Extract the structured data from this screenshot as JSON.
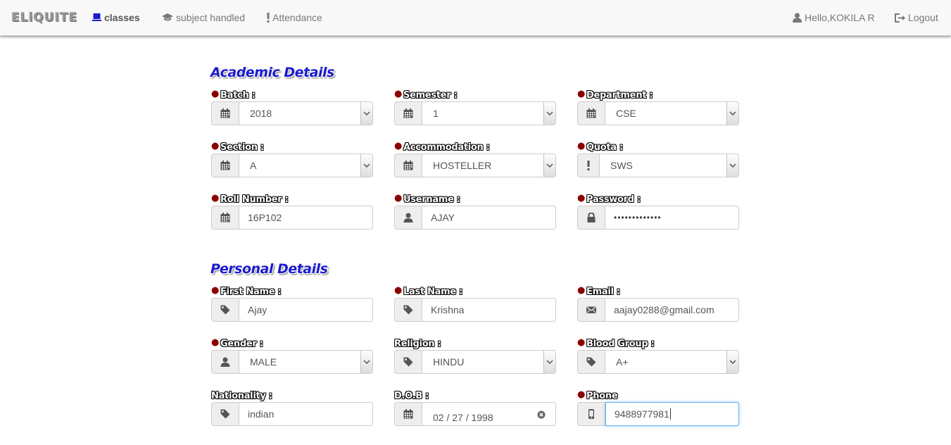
{
  "navbar": {
    "brand": "ELiQUITE",
    "items": [
      {
        "label": "classes",
        "icon": "laptop-icon",
        "active": true
      },
      {
        "label": "subject handled",
        "icon": "graduation-cap-icon"
      },
      {
        "label": "Attendance",
        "icon": "exclamation-icon"
      }
    ],
    "greeting": "Hello,KOKILA R",
    "logout": "Logout"
  },
  "academic": {
    "title": "Academic Details",
    "batch": {
      "label": "Batch :",
      "value": "2018",
      "icon": "calendar-icon",
      "required": true
    },
    "semester": {
      "label": "Semester :",
      "value": "1",
      "icon": "calendar-icon",
      "required": true
    },
    "department": {
      "label": "Department :",
      "value": "CSE",
      "icon": "calendar-icon",
      "required": true
    },
    "section": {
      "label": "Section :",
      "value": "A",
      "icon": "calendar-icon",
      "required": true
    },
    "accommodation": {
      "label": "Accommodation :",
      "value": "HOSTELLER",
      "icon": "calendar-icon",
      "required": true
    },
    "quota": {
      "label": "Quota :",
      "value": "SWS",
      "icon": "exclamation-icon",
      "required": true
    },
    "roll_number": {
      "label": "Roll Number :",
      "value": "16P102",
      "icon": "calendar-icon",
      "required": true
    },
    "username": {
      "label": "Username :",
      "value": "AJAY",
      "icon": "user-icon",
      "required": true
    },
    "password": {
      "label": "Password :",
      "value": "•••••••••••••",
      "icon": "lock-icon",
      "required": true
    }
  },
  "personal": {
    "title": "Personal Details",
    "first_name": {
      "label": "First Name :",
      "value": "Ajay",
      "icon": "tag-icon",
      "required": true
    },
    "last_name": {
      "label": "Last Name :",
      "value": "Krishna",
      "icon": "tag-icon",
      "required": true
    },
    "email": {
      "label": "Email :",
      "value": "aajay0288@gmail.com",
      "icon": "envelope-icon",
      "required": true
    },
    "gender": {
      "label": "Gender :",
      "value": "MALE",
      "icon": "user-icon",
      "required": true
    },
    "religion": {
      "label": "Religion :",
      "value": "HINDU",
      "icon": "tag-icon",
      "required": false
    },
    "blood_group": {
      "label": "Blood Group :",
      "value": "A+",
      "icon": "tag-icon",
      "required": true
    },
    "nationality": {
      "label": "Nationality :",
      "value": "indian",
      "icon": "tag-icon",
      "required": false
    },
    "dob": {
      "label": "D.O.B :",
      "value": "02 / 27 / 1998",
      "icon": "calendar-icon",
      "required": false
    },
    "phone": {
      "label": "Phone",
      "value": "9488977981",
      "icon": "mobile-icon",
      "required": true
    }
  },
  "colors": {
    "section_title": "#1a1acc",
    "required_marker": "#8b0000",
    "focus_border": "#66afe9"
  }
}
